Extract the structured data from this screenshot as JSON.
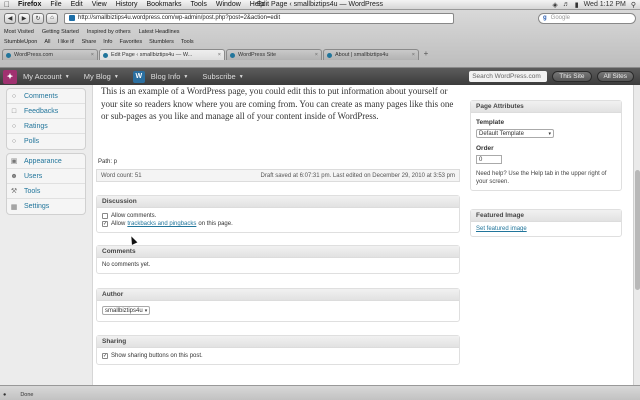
{
  "mac_menu": {
    "items": [
      "Firefox",
      "File",
      "Edit",
      "View",
      "History",
      "Bookmarks",
      "Tools",
      "Window",
      "Help"
    ],
    "window_title": "Edit Page ‹ smallbiztips4u — WordPress",
    "clock": "Wed 1:12 PM"
  },
  "browser": {
    "url": "http://smallbiztips4u.wordpress.com/wp-admin/post.php?post=2&action=edit",
    "search_placeholder": "Google",
    "bookmarks": [
      "Most Visited",
      "Getting Started",
      "Inspired by others",
      "Latest Headlines"
    ],
    "toolbar_items": [
      "StumbleUpon",
      "All",
      "I like it!",
      "Share",
      "Info",
      "Favorites",
      "Stumblers",
      "Tools"
    ],
    "tabs": [
      {
        "label": "WordPress.com",
        "active": false
      },
      {
        "label": "Edit Page ‹ smallbiztips4u — W...",
        "active": true
      },
      {
        "label": "WordPress Site",
        "active": false
      },
      {
        "label": "About | smallbiztips4u",
        "active": false
      }
    ]
  },
  "wp_admin_bar": {
    "my_account": "My Account",
    "my_blog": "My Blog",
    "blog_info": "Blog Info",
    "subscribe": "Subscribe",
    "search_placeholder": "Search WordPress.com",
    "this_site": "This Site",
    "all_sites": "All Sites"
  },
  "sidebar": {
    "group1": [
      {
        "label": "Comments",
        "icon": "comments-icon"
      },
      {
        "label": "Feedbacks",
        "icon": "feedbacks-icon"
      },
      {
        "label": "Ratings",
        "icon": "ratings-icon"
      },
      {
        "label": "Polls",
        "icon": "polls-icon"
      }
    ],
    "group2": [
      {
        "label": "Appearance",
        "icon": "appearance-icon"
      },
      {
        "label": "Users",
        "icon": "users-icon"
      },
      {
        "label": "Tools",
        "icon": "tools-icon"
      },
      {
        "label": "Settings",
        "icon": "settings-icon"
      }
    ]
  },
  "editor": {
    "content_text": "This is an example of a WordPress page, you could edit this to put information about yourself or your site so readers know where you are coming from. You can create as many pages like this one or sub-pages as you like and manage all of your content inside of WordPress.",
    "path": "Path: p",
    "word_count": "Word count: 51",
    "status_text": "Draft saved at 6:07:31 pm. Last edited on December 29, 2010 at 3:53 pm"
  },
  "discussion": {
    "title": "Discussion",
    "allow_comments": "Allow comments.",
    "allow_prefix": "Allow",
    "trackbacks_link": "trackbacks and pingbacks",
    "allow_suffix": "on this page."
  },
  "comments": {
    "title": "Comments",
    "empty_text": "No comments yet."
  },
  "author": {
    "title": "Author",
    "selected": "smallbiztips4u"
  },
  "sharing": {
    "title": "Sharing",
    "label": "Show sharing buttons on this post."
  },
  "page_attributes": {
    "title": "Page Attributes",
    "template_label": "Template",
    "template_value": "Default Template",
    "order_label": "Order",
    "order_value": "0",
    "help_text": "Need help? Use the Help tab in the upper right of your screen."
  },
  "featured_image": {
    "title": "Featured Image",
    "link": "Set featured image"
  },
  "statusbar": {
    "done": "Done"
  }
}
